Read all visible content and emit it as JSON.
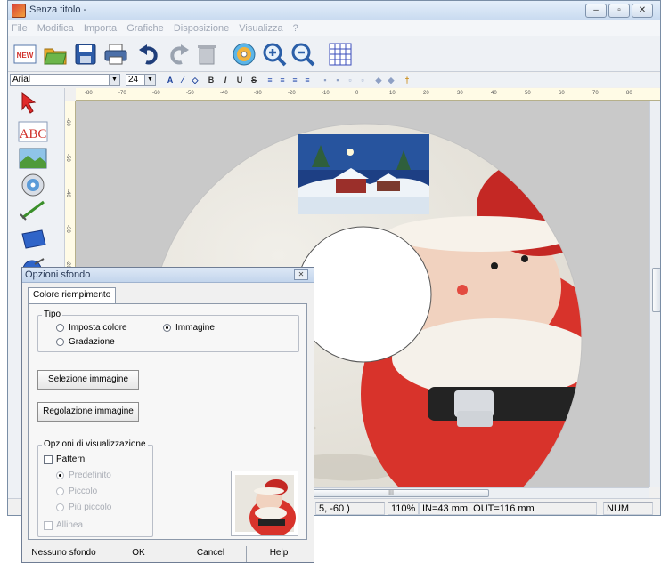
{
  "window": {
    "title": "Senza titolo -",
    "controls": [
      "–",
      "▫",
      "✕"
    ]
  },
  "menu": [
    "File",
    "Modifica",
    "Importa",
    "Grafiche",
    "Disposizione",
    "Visualizza",
    "?"
  ],
  "toolbar": {
    "new_label": "NEW"
  },
  "format_bar": {
    "font": "Arial",
    "size": "24",
    "bold": "B",
    "italic": "I",
    "underline": "U",
    "strike": "S"
  },
  "left_tools": {
    "text_tool_label": "ABC"
  },
  "ruler": {
    "h_ticks": [
      "-80",
      "-70",
      "-60",
      "-50",
      "-40",
      "-30",
      "-20",
      "-10",
      "0",
      "10",
      "20",
      "30",
      "40",
      "50",
      "60",
      "70",
      "80"
    ],
    "v_ticks": [
      "-60",
      "-50",
      "-40",
      "-30",
      "-20",
      "-10"
    ]
  },
  "status": {
    "coords": "5, -60 )",
    "zoom": "110%",
    "in_out": "IN=43 mm, OUT=116 mm",
    "num": "NUM"
  },
  "hscroll_grip": "III",
  "dialog": {
    "title": "Opzioni sfondo",
    "close": "✕",
    "tab": "Colore riempimento",
    "tipo_label": "Tipo",
    "opt_colore": "Imposta colore",
    "opt_gradazione": "Gradazione",
    "opt_immagine": "Immagine",
    "selected_tipo": "Immagine",
    "btn_selezione": "Selezione immagine",
    "btn_regolazione": "Regolazione immagine",
    "vis_label": "Opzioni di visualizzazione",
    "chk_pattern": "Pattern",
    "opt_predefinito": "Predefinito",
    "opt_piccolo": "Piccolo",
    "opt_piu_piccolo": "Più piccolo",
    "chk_allinea": "Allinea",
    "footer": [
      "Nessuno sfondo",
      "OK",
      "Cancel",
      "Help"
    ]
  },
  "colors": {
    "disc_rim": "#ececec",
    "santa_red": "#d8332b",
    "night_sky": "#1d3f84",
    "snow": "#eef3f8"
  }
}
